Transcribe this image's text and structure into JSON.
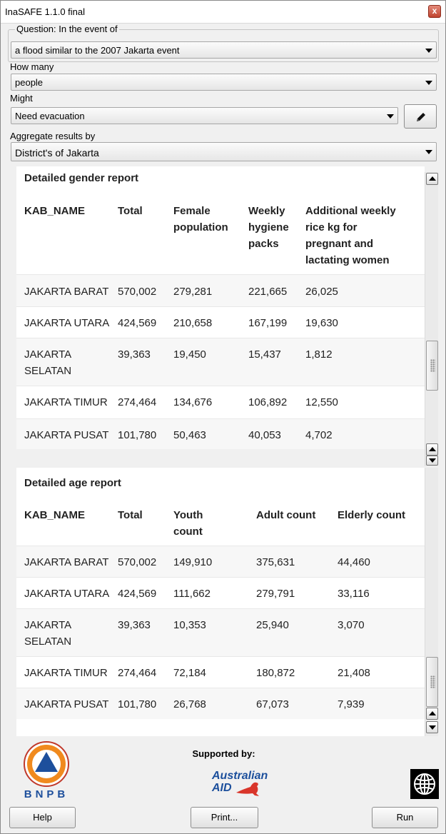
{
  "window": {
    "title": "InaSAFE 1.1.0 final",
    "close_glyph": "x"
  },
  "question": {
    "legend": "Question: In the event of",
    "hazard_value": "a flood similar to the 2007 Jakarta event",
    "how_many_label": "How many",
    "exposure_value": "people",
    "might_label": "Might",
    "function_value": "Need evacuation",
    "aggregate_label": "Aggregate results by",
    "aggregate_value": "District's of Jakarta"
  },
  "gender_report": {
    "title": "Detailed gender report",
    "headers": {
      "name": "KAB_NAME",
      "total": "Total",
      "female_1": "Female",
      "female_2": "population",
      "hygiene_1": "Weekly",
      "hygiene_2": "hygiene",
      "hygiene_3": "packs",
      "rice_1": "Additional weekly",
      "rice_2": "rice kg for",
      "rice_3": "pregnant and",
      "rice_4": "lactating women"
    },
    "rows": [
      {
        "name_1": "JAKARTA BARAT",
        "name_2": "",
        "total": "570,002",
        "female": "279,281",
        "hygiene": "221,665",
        "rice": "26,025"
      },
      {
        "name_1": "JAKARTA UTARA",
        "name_2": "",
        "total": "424,569",
        "female": "210,658",
        "hygiene": "167,199",
        "rice": "19,630"
      },
      {
        "name_1": "JAKARTA",
        "name_2": "SELATAN",
        "total": "39,363",
        "female": "19,450",
        "hygiene": "15,437",
        "rice": "1,812"
      },
      {
        "name_1": "JAKARTA TIMUR",
        "name_2": "",
        "total": "274,464",
        "female": "134,676",
        "hygiene": "106,892",
        "rice": "12,550"
      },
      {
        "name_1": "JAKARTA PUSAT",
        "name_2": "",
        "total": "101,780",
        "female": "50,463",
        "hygiene": "40,053",
        "rice": "4,702"
      }
    ]
  },
  "age_report": {
    "title": "Detailed age report",
    "headers": {
      "name": "KAB_NAME",
      "total": "Total",
      "youth_1": "Youth",
      "youth_2": "count",
      "adult": "Adult count",
      "elderly": "Elderly count"
    },
    "rows": [
      {
        "name_1": "JAKARTA BARAT",
        "name_2": "",
        "total": "570,002",
        "youth": "149,910",
        "adult": "375,631",
        "elderly": "44,460"
      },
      {
        "name_1": "JAKARTA UTARA",
        "name_2": "",
        "total": "424,569",
        "youth": "111,662",
        "adult": "279,791",
        "elderly": "33,116"
      },
      {
        "name_1": "JAKARTA",
        "name_2": "SELATAN",
        "total": "39,363",
        "youth": "10,353",
        "adult": "25,940",
        "elderly": "3,070"
      },
      {
        "name_1": "JAKARTA TIMUR",
        "name_2": "",
        "total": "274,464",
        "youth": "72,184",
        "adult": "180,872",
        "elderly": "21,408"
      },
      {
        "name_1": "JAKARTA PUSAT",
        "name_2": "",
        "total": "101,780",
        "youth": "26,768",
        "adult": "67,073",
        "elderly": "7,939"
      }
    ]
  },
  "footer": {
    "supported_by": "Supported by:",
    "bnpb_text": "BNPB",
    "ausaid_line1": "Australian",
    "ausaid_line2": "AID",
    "buttons": {
      "help": "Help",
      "print": "Print...",
      "run": "Run"
    }
  },
  "colors": {
    "ausaid_blue": "#1c4f9c",
    "bnpb_orange": "#f08a1e",
    "bnpb_blue": "#1d4f9c",
    "kangaroo_red": "#d9352a"
  }
}
